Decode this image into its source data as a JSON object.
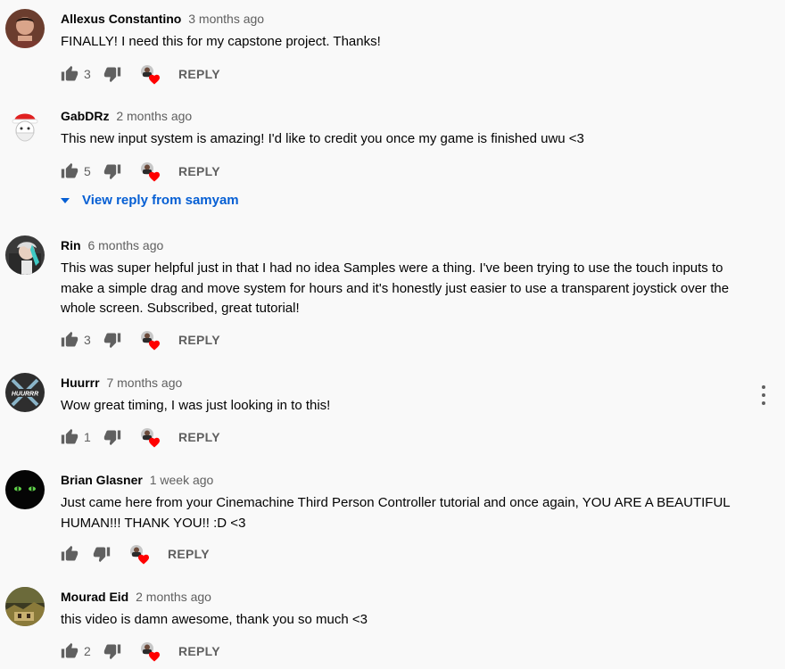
{
  "comments": [
    {
      "author": "Allexus Constantino",
      "time": "3 months ago",
      "text": "FINALLY! I need this for my capstone project. Thanks!",
      "likes": "3",
      "reply_label": "REPLY",
      "avatar_icon": "person-photo-avatar"
    },
    {
      "author": "GabDRz",
      "time": "2 months ago",
      "text": "This new input system is amazing! I'd like to credit you once my game is finished uwu <3",
      "likes": "5",
      "reply_label": "REPLY",
      "view_replies": "View reply from samyam",
      "avatar_icon": "santa-hat-avatar"
    },
    {
      "author": "Rin",
      "time": "6 months ago",
      "text": "This was super helpful just in that I had no idea Samples were a thing.  I've been trying to use the touch inputs to make a simple drag and move system for hours and it's honestly just easier to use a transparent joystick over the whole screen.  Subscribed, great tutorial!",
      "likes": "3",
      "reply_label": "REPLY",
      "avatar_icon": "anime-character-avatar"
    },
    {
      "author": "Huurrr",
      "time": "7 months ago",
      "text": "Wow great timing, I was just looking in to this!",
      "likes": "1",
      "reply_label": "REPLY",
      "avatar_icon": "swords-logo-avatar",
      "avatar_text": "HUURRR"
    },
    {
      "author": "Brian Glasner",
      "time": "1 week ago",
      "text": "Just came here from your Cinemachine Third Person Controller tutorial and once again, YOU ARE A BEAUTIFUL HUMAN!!! THANK YOU!! :D <3",
      "likes": "",
      "reply_label": "REPLY",
      "avatar_icon": "black-cat-eyes-avatar"
    },
    {
      "author": "Mourad Eid",
      "time": "2 months ago",
      "text": "this video is damn awesome, thank you so much <3",
      "likes": "2",
      "reply_label": "REPLY",
      "avatar_icon": "landscape-photo-avatar"
    }
  ],
  "colors": {
    "background": "#f9f9f9",
    "link_blue": "#065fd4",
    "secondary_text": "#606060",
    "heart_red": "#ff0000"
  }
}
